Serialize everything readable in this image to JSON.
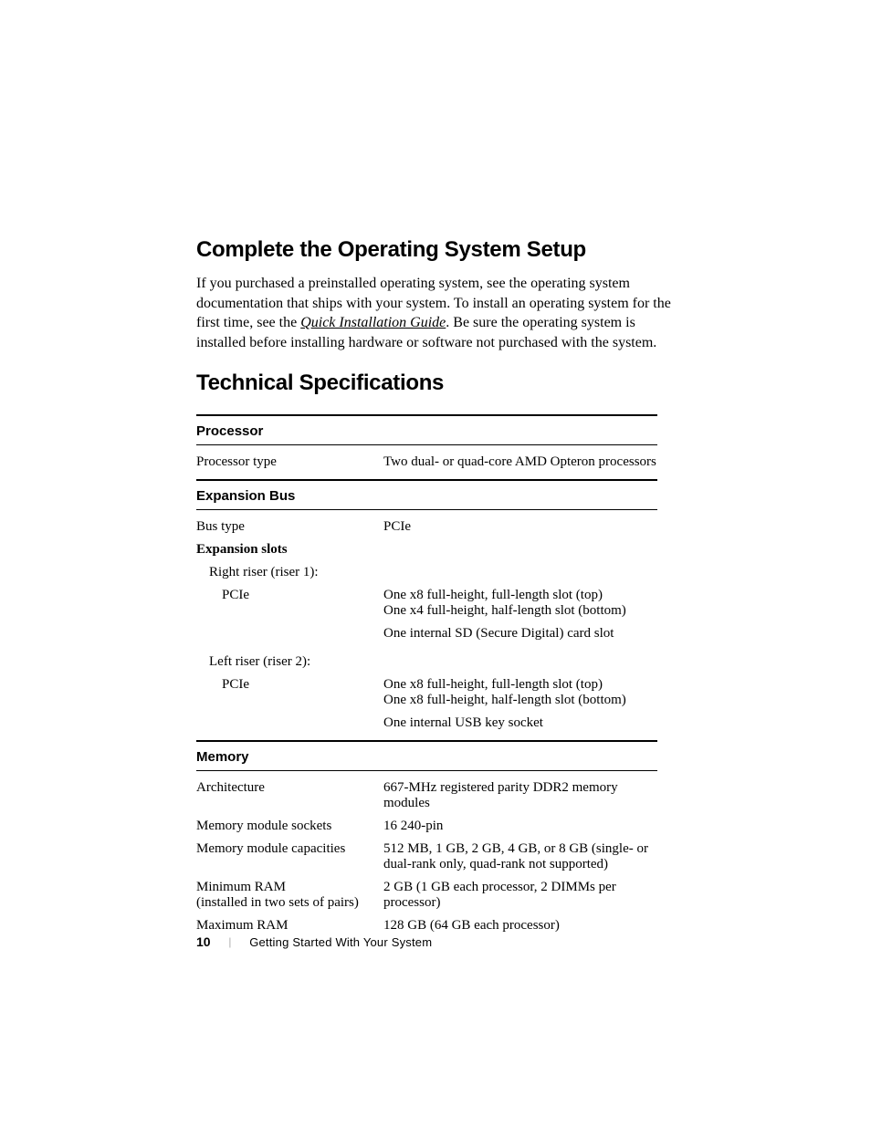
{
  "headings": {
    "h1": "Complete the Operating System Setup",
    "h2": "Technical Specifications"
  },
  "paragraph": {
    "before": "If you purchased a preinstalled operating system, see the operating system documentation that ships with your system. To install an operating system for the first time, see the ",
    "link": "Quick Installation Guide",
    "after": ". Be sure the operating system is installed before installing hardware or software not purchased with the system."
  },
  "spec": {
    "processor": {
      "header": "Processor",
      "type_label": "Processor type",
      "type_value": "Two dual- or quad-core AMD Opteron processors"
    },
    "expansion": {
      "header": "Expansion Bus",
      "bus_label": "Bus type",
      "bus_value": "PCIe",
      "slots_label": "Expansion slots",
      "riser1_label": "Right riser (riser 1):",
      "riser1_pcie_label": "PCIe",
      "riser1_pcie_value": "One x8 full-height, full-length slot (top)\nOne x4 full-height, half-length slot (bottom)",
      "riser1_sd_value": "One internal SD (Secure Digital) card slot",
      "riser2_label": "Left riser (riser 2):",
      "riser2_pcie_label": "PCIe",
      "riser2_pcie_value": "One x8 full-height, full-length slot (top)\nOne x8 full-height, half-length slot (bottom)",
      "riser2_usb_value": "One internal USB key socket"
    },
    "memory": {
      "header": "Memory",
      "arch_label": "Architecture",
      "arch_value": "667-MHz registered parity DDR2 memory modules",
      "sockets_label": "Memory module sockets",
      "sockets_value": "16 240-pin",
      "capacities_label": "Memory module capacities",
      "capacities_value": "512 MB, 1 GB, 2 GB, 4 GB, or 8 GB (single- or dual-rank only, quad-rank not supported)",
      "min_label": "Minimum RAM\n(installed in two sets of pairs)",
      "min_value": "2 GB (1 GB each processor, 2 DIMMs per processor)",
      "max_label": "Maximum RAM",
      "max_value": "128 GB (64 GB each processor)"
    }
  },
  "footer": {
    "page": "10",
    "divider": "|",
    "section": "Getting Started With Your System"
  }
}
